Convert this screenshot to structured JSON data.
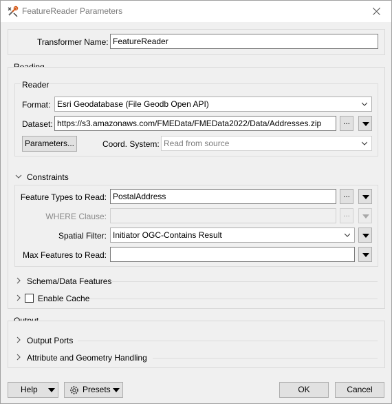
{
  "window": {
    "title": "FeatureReader Parameters",
    "close_glyph": "✕"
  },
  "transformer": {
    "label": "Transformer Name:",
    "value": "FeatureReader"
  },
  "reading": {
    "group_label": "Reading",
    "reader_label": "Reader",
    "format": {
      "label": "Format:",
      "value": "Esri Geodatabase (File Geodb Open API)"
    },
    "dataset": {
      "label": "Dataset:",
      "value": "https://s3.amazonaws.com/FMEData/FMEData2022/Data/Addresses.zip",
      "browse": "..."
    },
    "parameters_button": "Parameters...",
    "coord_system": {
      "label": "Coord. System:",
      "value": "Read from source"
    }
  },
  "constraints": {
    "label": "Constraints",
    "feature_types": {
      "label": "Feature Types to Read:",
      "value": "PostalAddress",
      "browse": "..."
    },
    "where_clause": {
      "label": "WHERE Clause:",
      "value": "",
      "browse": "..."
    },
    "spatial_filter": {
      "label": "Spatial Filter:",
      "value": "Initiator OGC-Contains Result"
    },
    "max_features": {
      "label": "Max Features to Read:",
      "value": ""
    }
  },
  "schema_data_features": {
    "label": "Schema/Data Features"
  },
  "enable_cache": {
    "label": "Enable Cache",
    "checked": false
  },
  "output": {
    "group_label": "Output",
    "output_ports": "Output Ports",
    "attribute_geometry": "Attribute and Geometry Handling"
  },
  "footer": {
    "help": "Help",
    "presets": "Presets",
    "ok": "OK",
    "cancel": "Cancel"
  }
}
